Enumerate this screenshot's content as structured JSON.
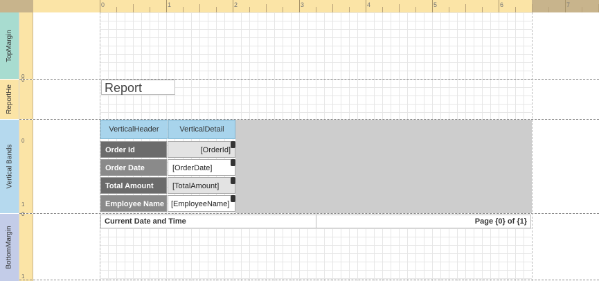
{
  "ruler": {
    "marks": [
      "0",
      "1",
      "2",
      "3",
      "4",
      "5",
      "6",
      "7"
    ]
  },
  "bands": {
    "top_margin": {
      "label": "TopMargin",
      "ruler_marks": [
        "0"
      ]
    },
    "report_header": {
      "label": "ReportHe",
      "ruler_marks": [
        "0"
      ]
    },
    "vertical_bands": {
      "label": "Vertical Bands",
      "ruler_marks": [
        "0",
        "1"
      ]
    },
    "bottom_margin": {
      "label": "BottomMargin",
      "ruler_marks": [
        "0",
        "1"
      ]
    }
  },
  "report": {
    "title": "Report"
  },
  "vertical": {
    "header_label": "VerticalHeader",
    "detail_label": "VerticalDetail",
    "rows": [
      {
        "label": "Order Id",
        "field": "[OrderId]",
        "label_color": "#6b6b6b",
        "field_align": "right"
      },
      {
        "label": "Order Date",
        "field": "[OrderDate]",
        "label_color": "#8a8a8a",
        "field_align": "left"
      },
      {
        "label": "Total Amount",
        "field": "[TotalAmount]",
        "label_color": "#6b6b6b",
        "field_align": "left"
      },
      {
        "label": "Employee Name",
        "field": "[EmployeeName]",
        "label_color": "#8a8a8a",
        "field_align": "left"
      }
    ]
  },
  "footer": {
    "left_text": "Current Date and Time",
    "right_text": "Page {0} of {1}"
  },
  "colors": {
    "ruler": "#fbe4a6",
    "band_top_margin": "#a8dcd0",
    "band_report_header": "#fbe4a6",
    "band_vertical": "#b5d9ee",
    "band_bottom_margin": "#c3cce8",
    "vertical_header": "#a8d4ec"
  }
}
